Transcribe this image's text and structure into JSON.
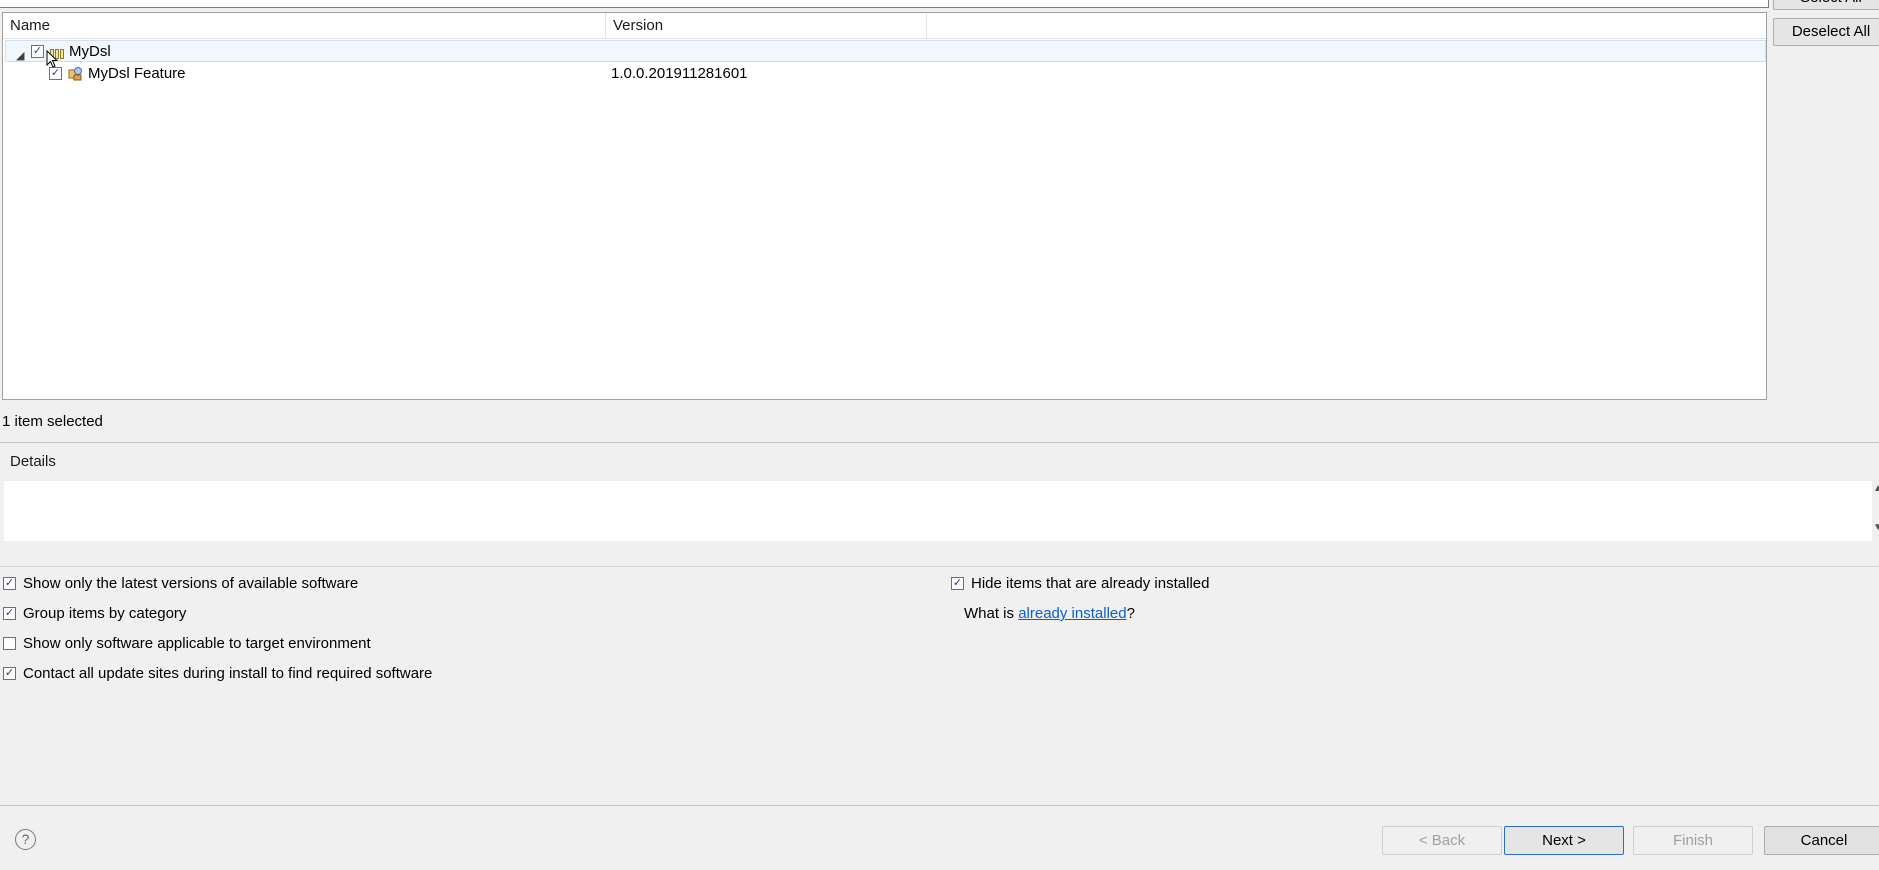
{
  "top": {
    "select_all_label": "Select All",
    "deselect_all_label": "Deselect All"
  },
  "table": {
    "columns": [
      "Name",
      "Version"
    ],
    "rows": [
      {
        "name": "MyDsl",
        "version": "",
        "checked": true,
        "expanded": true,
        "icon": "category-icon"
      },
      {
        "name": "MyDsl Feature",
        "version": "1.0.0.201911281601",
        "checked": true,
        "icon": "feature-icon"
      }
    ]
  },
  "status": {
    "selection": "1 item selected"
  },
  "details": {
    "label": "Details"
  },
  "options": {
    "latest": {
      "label": "Show only the latest versions of available software",
      "checked": true
    },
    "group": {
      "label": "Group items by category",
      "checked": true
    },
    "target": {
      "label": "Show only software applicable to target environment",
      "checked": false
    },
    "contact": {
      "label": "Contact all update sites during install to find required software",
      "checked": true
    },
    "hide": {
      "label": "Hide items that are already installed",
      "checked": true
    }
  },
  "what_is": {
    "prefix": "What is ",
    "link": "already installed",
    "suffix": "?"
  },
  "buttons": {
    "help": "?",
    "back": "< Back",
    "next": "Next >",
    "finish": "Finish",
    "cancel": "Cancel"
  },
  "colors": {
    "accent": "#2c6fc4",
    "link": "#0b5fc7",
    "selection_row": "#f2f7fc"
  }
}
